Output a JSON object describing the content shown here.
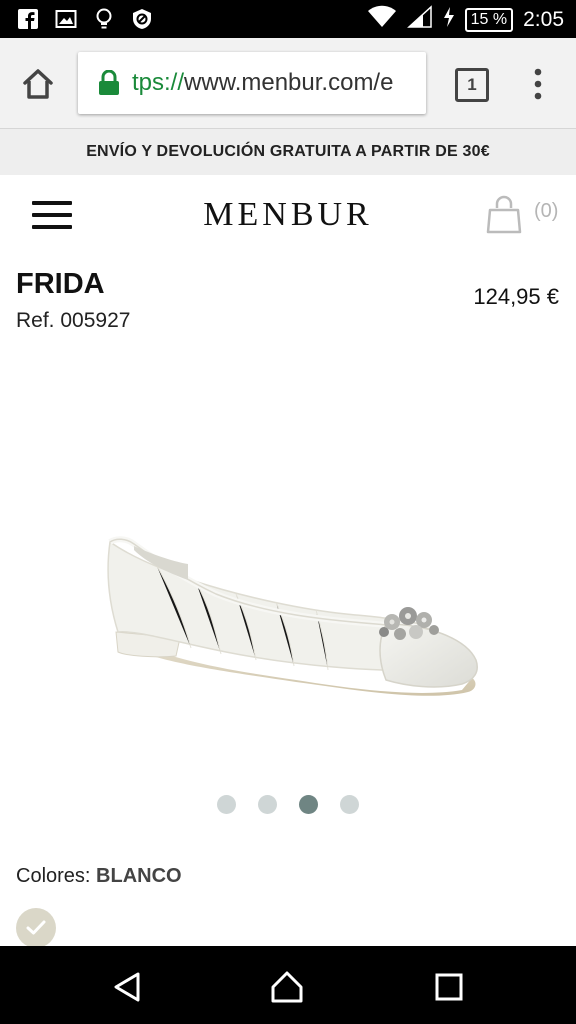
{
  "status_bar": {
    "battery": "15 %",
    "time": "2:05"
  },
  "browser": {
    "url_scheme": "tps://",
    "url_host": "www.menbur.com/e",
    "tab_count": "1"
  },
  "promo": {
    "text": "ENVÍO Y DEVOLUCIÓN GRATUITA A PARTIR DE 30€"
  },
  "site": {
    "logo": "MENBUR",
    "cart_count": "(0)"
  },
  "product": {
    "title": "FRIDA",
    "ref": "Ref. 005927",
    "price": "124,95 €",
    "gallery_active_index": 2,
    "gallery_count": 4,
    "colors_label": "Colores:",
    "colors_value": "BLANCO",
    "swatch_color": "#dad7c8"
  },
  "colors": {
    "lock_green": "#1a8a3a",
    "dot_active": "#6f8583",
    "dot_inactive": "#cfd6d6"
  }
}
